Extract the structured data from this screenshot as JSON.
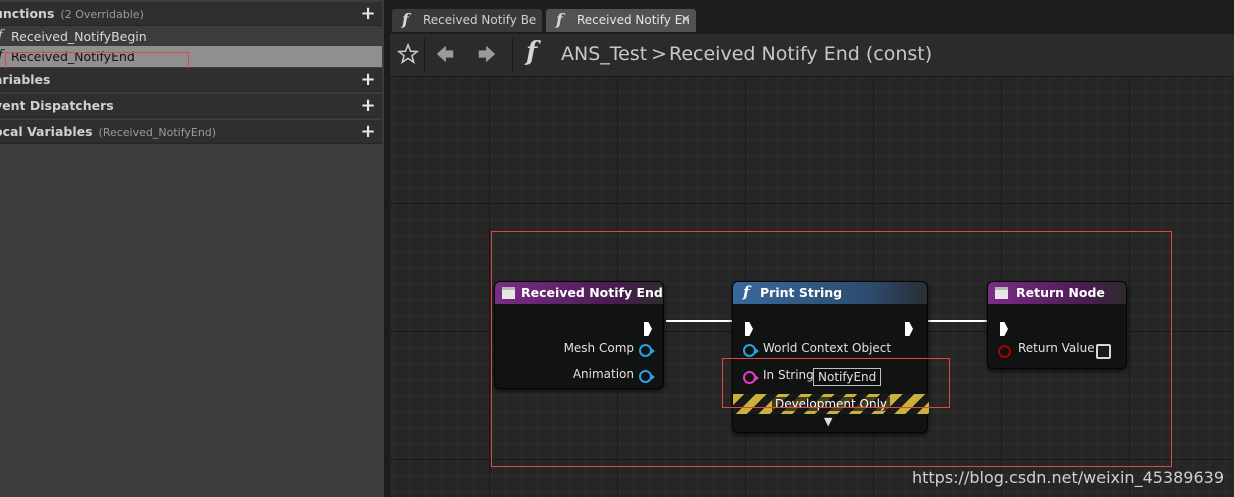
{
  "my_blueprint": {
    "categories": [
      {
        "label": "unctions",
        "sub": "(2 Overridable)"
      },
      {
        "label": "ariables",
        "sub": ""
      },
      {
        "label": "vent Dispatchers",
        "sub": ""
      },
      {
        "label": "ocal Variables",
        "sub": "(Received_NotifyEnd)"
      }
    ],
    "functions": [
      {
        "label": "Received_NotifyBegin"
      },
      {
        "label": "Received_NotifyEnd"
      }
    ],
    "plus": "+",
    "fn_glyph": "f"
  },
  "tabs": [
    {
      "label": "Received Notify Be",
      "glyph": "f"
    },
    {
      "label": "Received Notify En",
      "glyph": "f",
      "close": "×"
    }
  ],
  "breadcrumb": {
    "blueprint": "ANS_Test",
    "separator": ">",
    "function": "Received Notify End (const)",
    "glyph": "f",
    "icons": [
      "star-icon",
      "arrow-left-icon",
      "arrow-right-icon"
    ]
  },
  "nodes": {
    "received_notify_end": {
      "title": "Received Notify End",
      "pins": [
        "Mesh Comp",
        "Animation"
      ]
    },
    "print_string": {
      "title": "Print String",
      "glyph": "f",
      "pins": [
        "World Context Object",
        "In String"
      ],
      "in_string_value": "NotifyEnd",
      "dev_label": "Development Only",
      "expand": "▼"
    },
    "return_node": {
      "title": "Return Node",
      "pins": [
        "Return Value"
      ]
    }
  },
  "colors": {
    "event_header": "#7a2e86",
    "function_header": "#38689c",
    "object_pin": "#29a3e6",
    "string_pin": "#e63ac8",
    "bool_pin": "#aa0000",
    "highlight": "#e04848"
  },
  "watermark": "https://blog.csdn.net/weixin_45389639"
}
